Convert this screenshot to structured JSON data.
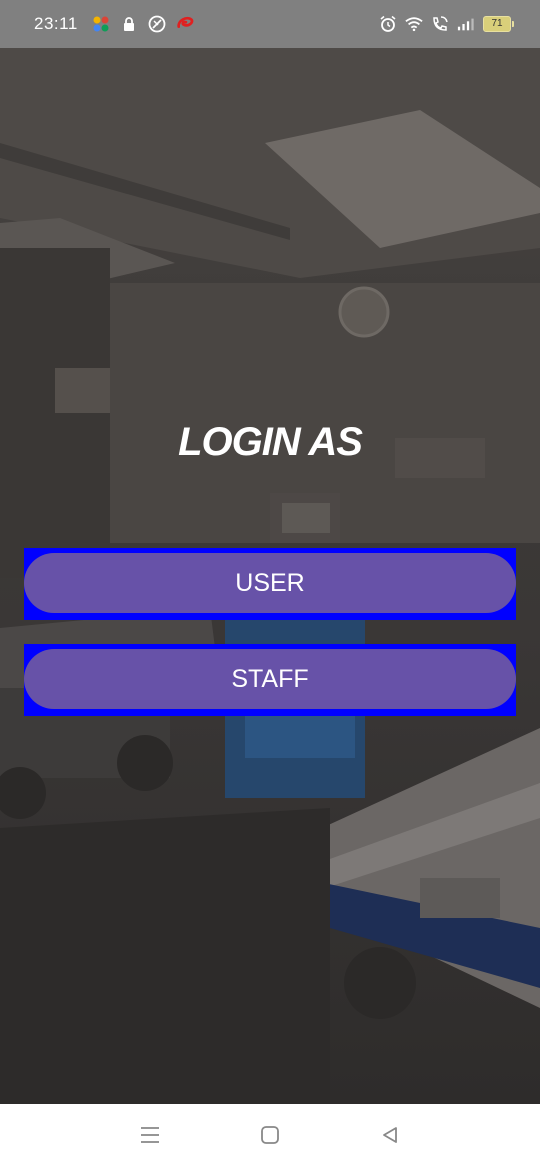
{
  "status_bar": {
    "time": "23:11",
    "battery_level": "71",
    "left_icons": [
      "app-icon",
      "lock-icon",
      "shield-icon",
      "airtel-icon"
    ],
    "right_icons": [
      "alarm-icon",
      "wifi-icon",
      "wifi-call-icon",
      "signal-icon",
      "battery-icon"
    ]
  },
  "login": {
    "title": "LOGIN AS",
    "user_label": "USER",
    "staff_label": "STAFF"
  },
  "colors": {
    "button_fill": "#6752a8",
    "button_frame": "#0000ff",
    "status_bar": "#808080"
  },
  "nav_bar": {
    "icons": [
      "recents-icon",
      "home-icon",
      "back-icon"
    ]
  }
}
